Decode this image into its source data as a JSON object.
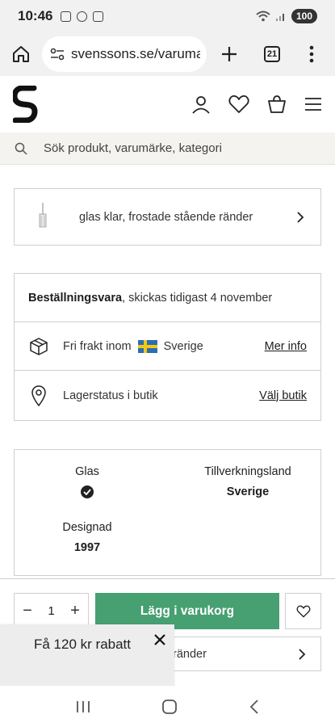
{
  "status_bar": {
    "time": "10:46",
    "battery": "100"
  },
  "browser": {
    "url": "svenssons.se/varumarken",
    "tab_count": "21"
  },
  "search": {
    "placeholder": "Sök produkt, varumärke, kategori"
  },
  "variant": {
    "label": "glas klar, frostade stående ränder"
  },
  "delivery": {
    "order_item_bold": "Beställningsvara",
    "order_item_rest": ", skickas tidigast 4 november",
    "shipping_text": "Fri frakt inom",
    "shipping_country": "Sverige",
    "shipping_link": "Mer info",
    "stock_text": "Lagerstatus i butik",
    "stock_link": "Välj butik"
  },
  "specs": {
    "glass_label": "Glas",
    "country_label": "Tillverkningsland",
    "country_value": "Sverige",
    "designed_label": "Designad",
    "designed_value": "1997"
  },
  "cart": {
    "quantity": "1",
    "minus": "−",
    "plus": "+",
    "add_label": "Lägg i varukorg"
  },
  "variant_bottom": {
    "visible_tail": "ränder"
  },
  "promo": {
    "text": "Få 120 kr rabatt"
  },
  "colors": {
    "accent_green": "#46a071",
    "search_bg": "#f4f3ef",
    "chrome_bg": "#f1f1f1"
  }
}
